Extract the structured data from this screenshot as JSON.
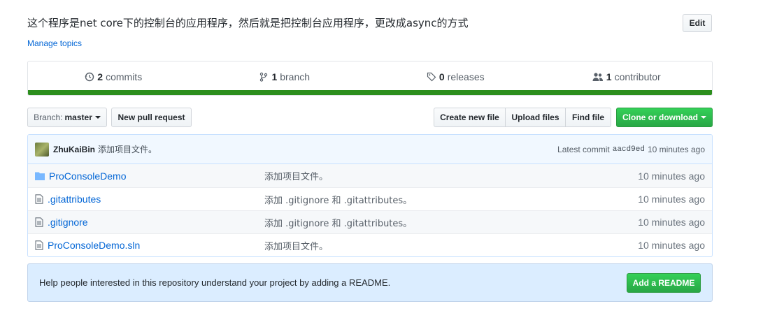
{
  "repo": {
    "description": "这个程序是net core下的控制台的应用程序，然后就是把控制台应用程序，更改成async的方式",
    "manage_topics": "Manage topics",
    "edit_label": "Edit"
  },
  "summary": {
    "commits": {
      "count": "2",
      "label": "commits"
    },
    "branches": {
      "count": "1",
      "label": "branch"
    },
    "releases": {
      "count": "0",
      "label": "releases"
    },
    "contributors": {
      "count": "1",
      "label": "contributor"
    },
    "language_bar_color": "#2c8e1d"
  },
  "toolbar": {
    "branch_label": "Branch:",
    "branch_value": "master",
    "new_pr": "New pull request",
    "create_file": "Create new file",
    "upload_files": "Upload files",
    "find_file": "Find file",
    "clone": "Clone or download"
  },
  "commit": {
    "author": "ZhuKaiBin",
    "message": "添加项目文件。",
    "latest_label": "Latest commit",
    "sha": "aacd9ed",
    "age": "10 minutes ago"
  },
  "files": [
    {
      "name": "ProConsoleDemo",
      "type": "folder",
      "message": "添加项目文件。",
      "age": "10 minutes ago"
    },
    {
      "name": ".gitattributes",
      "type": "file",
      "message": "添加 .gitignore 和 .gitattributes。",
      "age": "10 minutes ago"
    },
    {
      "name": ".gitignore",
      "type": "file",
      "message": "添加 .gitignore 和 .gitattributes。",
      "age": "10 minutes ago"
    },
    {
      "name": "ProConsoleDemo.sln",
      "type": "file",
      "message": "添加项目文件。",
      "age": "10 minutes ago"
    }
  ],
  "readme": {
    "text": "Help people interested in this repository understand your project by adding a README.",
    "button": "Add a README"
  },
  "colors": {
    "link": "#0366d6",
    "green": "#28a745",
    "readme_bg": "#dbedff"
  }
}
